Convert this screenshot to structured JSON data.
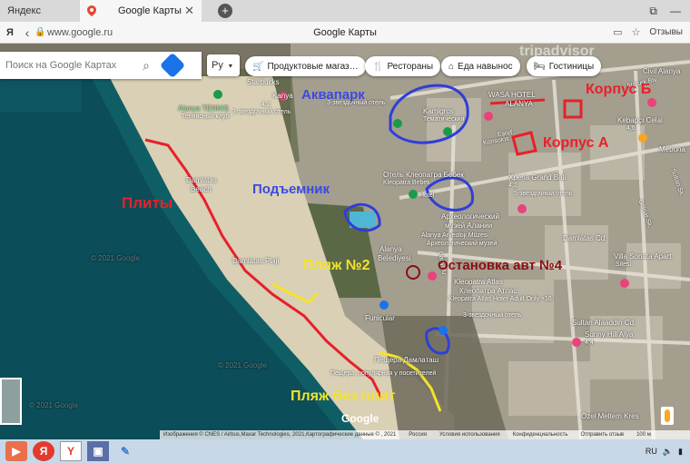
{
  "browser": {
    "tabs": [
      {
        "label": "Яндекс"
      },
      {
        "label": "Google Карты"
      }
    ],
    "new_tab": "+",
    "url": "www.google.ru",
    "page_title": "Google Карты",
    "reviews_label": "Отзывы"
  },
  "maps": {
    "search_placeholder": "Поиск на Google Картах",
    "language": "Ру",
    "chips": [
      {
        "label": "Продуктовые магаз…",
        "icon": "cart-icon"
      },
      {
        "label": "Рестораны",
        "icon": "fork-knife-icon"
      },
      {
        "label": "Еда навынос",
        "icon": "takeout-icon"
      },
      {
        "label": "Гостиницы",
        "icon": "bed-icon"
      }
    ],
    "place_labels": [
      "Starbucks",
      "Alanya TENNIS",
      "Теннисный клуб",
      "Kanya",
      "4,2",
      "3-звездочный отель",
      "3-звездочный отель",
      "Kamigros",
      "Тематический",
      "WASA HOTEL",
      "ALANYA",
      "Kebapçı Celal",
      "4,6",
      "Mebona",
      "Civil Alanya",
      "Отель Клеопатра Бебек",
      "Kleopatra Bebek",
      "Hotel",
      "Xperia Grand Bali",
      "4,2",
      "5-звездочный отель",
      "Damlatas",
      "Beach",
      "Археологический",
      "музей Алании",
      "Alanya Arkeoloji Müzesi",
      "Археологический музей",
      "Alanya",
      "Belediyesi",
      "Damlatas Cd.",
      "Villa Sonata Apart",
      "Damlatas Plaji",
      "Sitesi",
      "Kleopatra Atlas",
      "Клеопатра Атлас",
      "Kleopatra Atlas Hotel-Adult Only +16",
      "3-звездочный отель",
      "Funicular",
      "Sultan Alaaddin Cd.",
      "Sunny Hill Alya",
      "4,4",
      "Пещера Дамлаташ",
      "Пещера, популярная у посетителей",
      "Özel Meltem Kres",
      "© 2021 Google",
      "© 2021 Google",
      "© 2021 Google",
      "Eşref",
      "Konsolos",
      "Ataturk Blv.",
      "Gülnar Sk.",
      "Sultan Sk.",
      "Dagyolu"
    ],
    "google_logo": "Google",
    "attribution": [
      "Изображения © CNES / Airbus,Maxar Technologies, 2021,Картографические данные © , 2021",
      "Россия",
      "Условия использования",
      "Конфиденциальность",
      "Отправить отзыв",
      "100 м"
    ]
  },
  "annotations": {
    "plity": "Плиты",
    "podemnik": "Подъемник",
    "plyazh2": "Пляж №2",
    "ostanovka": "Остановка авт №4",
    "plyazh_bez_plit": "Пляж без плит",
    "korpus_b": "Корпус Б",
    "korpus_a": "Корпус А",
    "akvapark": "Аквапарк",
    "colors": {
      "red": "#e8202a",
      "blue": "#2f3fd6",
      "yellow": "#f5e32a",
      "darkred": "#8b0d12"
    }
  },
  "taskbar": {
    "items": [
      "media-player-icon",
      "yandex-icon",
      "yandex-browser-icon",
      "save-icon",
      "paint-icon"
    ],
    "lang": "RU"
  },
  "watermark": "tripadvisor"
}
